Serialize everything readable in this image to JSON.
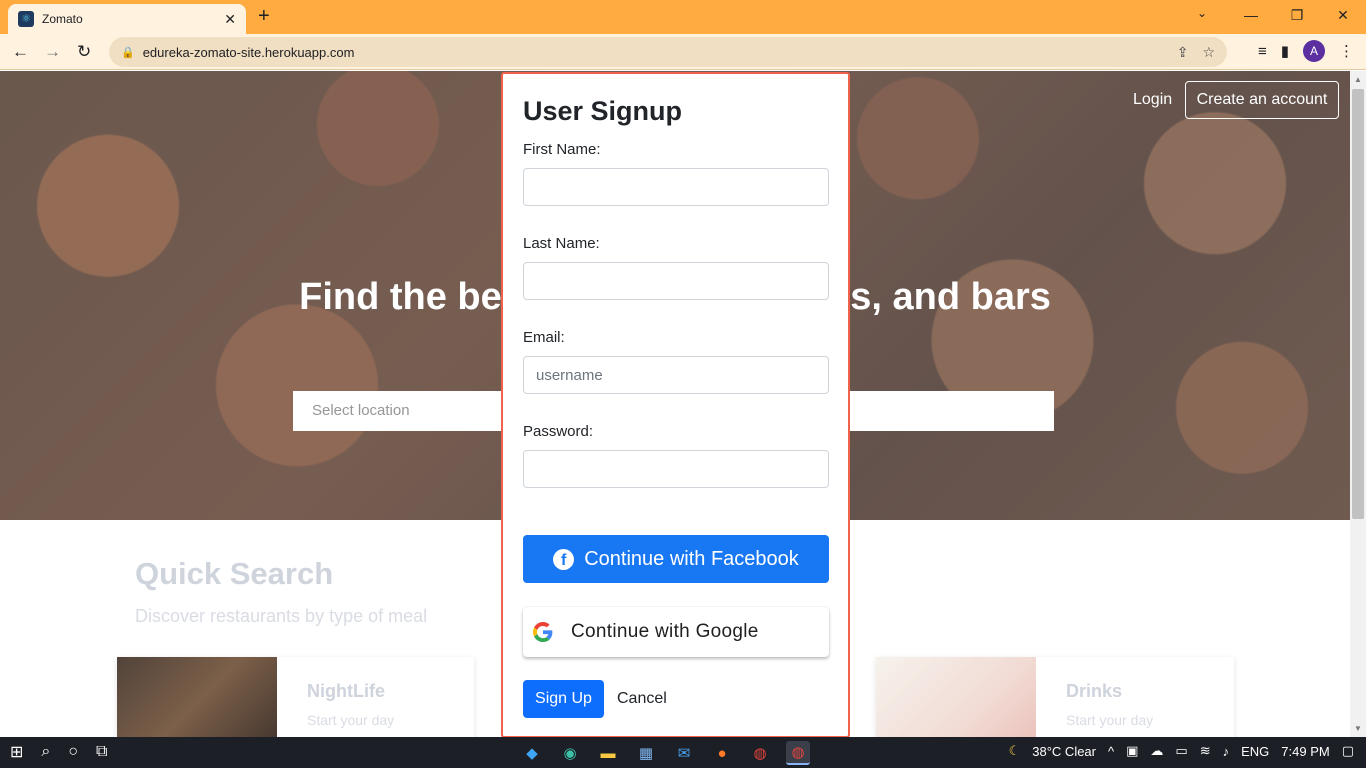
{
  "browser": {
    "tab_title": "Zomato",
    "tab_close": "✕",
    "new_tab": "+",
    "url": "edureka-zomato-site.herokuapp.com",
    "profile_initial": "A",
    "win_minimize": "—",
    "win_restore": "❐",
    "win_close": "✕"
  },
  "hero": {
    "heading": "Find the best restaurants, cafés, and bars",
    "location_placeholder": "Select location",
    "login": "Login",
    "create_account": "Create an account"
  },
  "quick_search": {
    "title": "Quick Search",
    "subtitle": "Discover restaurants by type of meal",
    "cards": [
      {
        "title": "NightLife",
        "desc": "Start your day"
      },
      {
        "title": "Drinks",
        "desc": "Start your day"
      }
    ]
  },
  "modal": {
    "title": "User Signup",
    "first_name_label": "First Name:",
    "last_name_label": "Last Name:",
    "email_label": "Email:",
    "email_placeholder": "username",
    "password_label": "Password:",
    "facebook_button": "Continue with Facebook",
    "google_button": "Continue with Google",
    "signup_button": "Sign Up",
    "cancel_button": "Cancel"
  },
  "taskbar": {
    "weather": "38°C  Clear",
    "language": "ENG",
    "time": "7:49 PM"
  },
  "colors": {
    "tab_bar": "#ffab40",
    "modal_border": "#f0624a",
    "facebook": "#1877f2",
    "primary": "#0d6efd"
  }
}
